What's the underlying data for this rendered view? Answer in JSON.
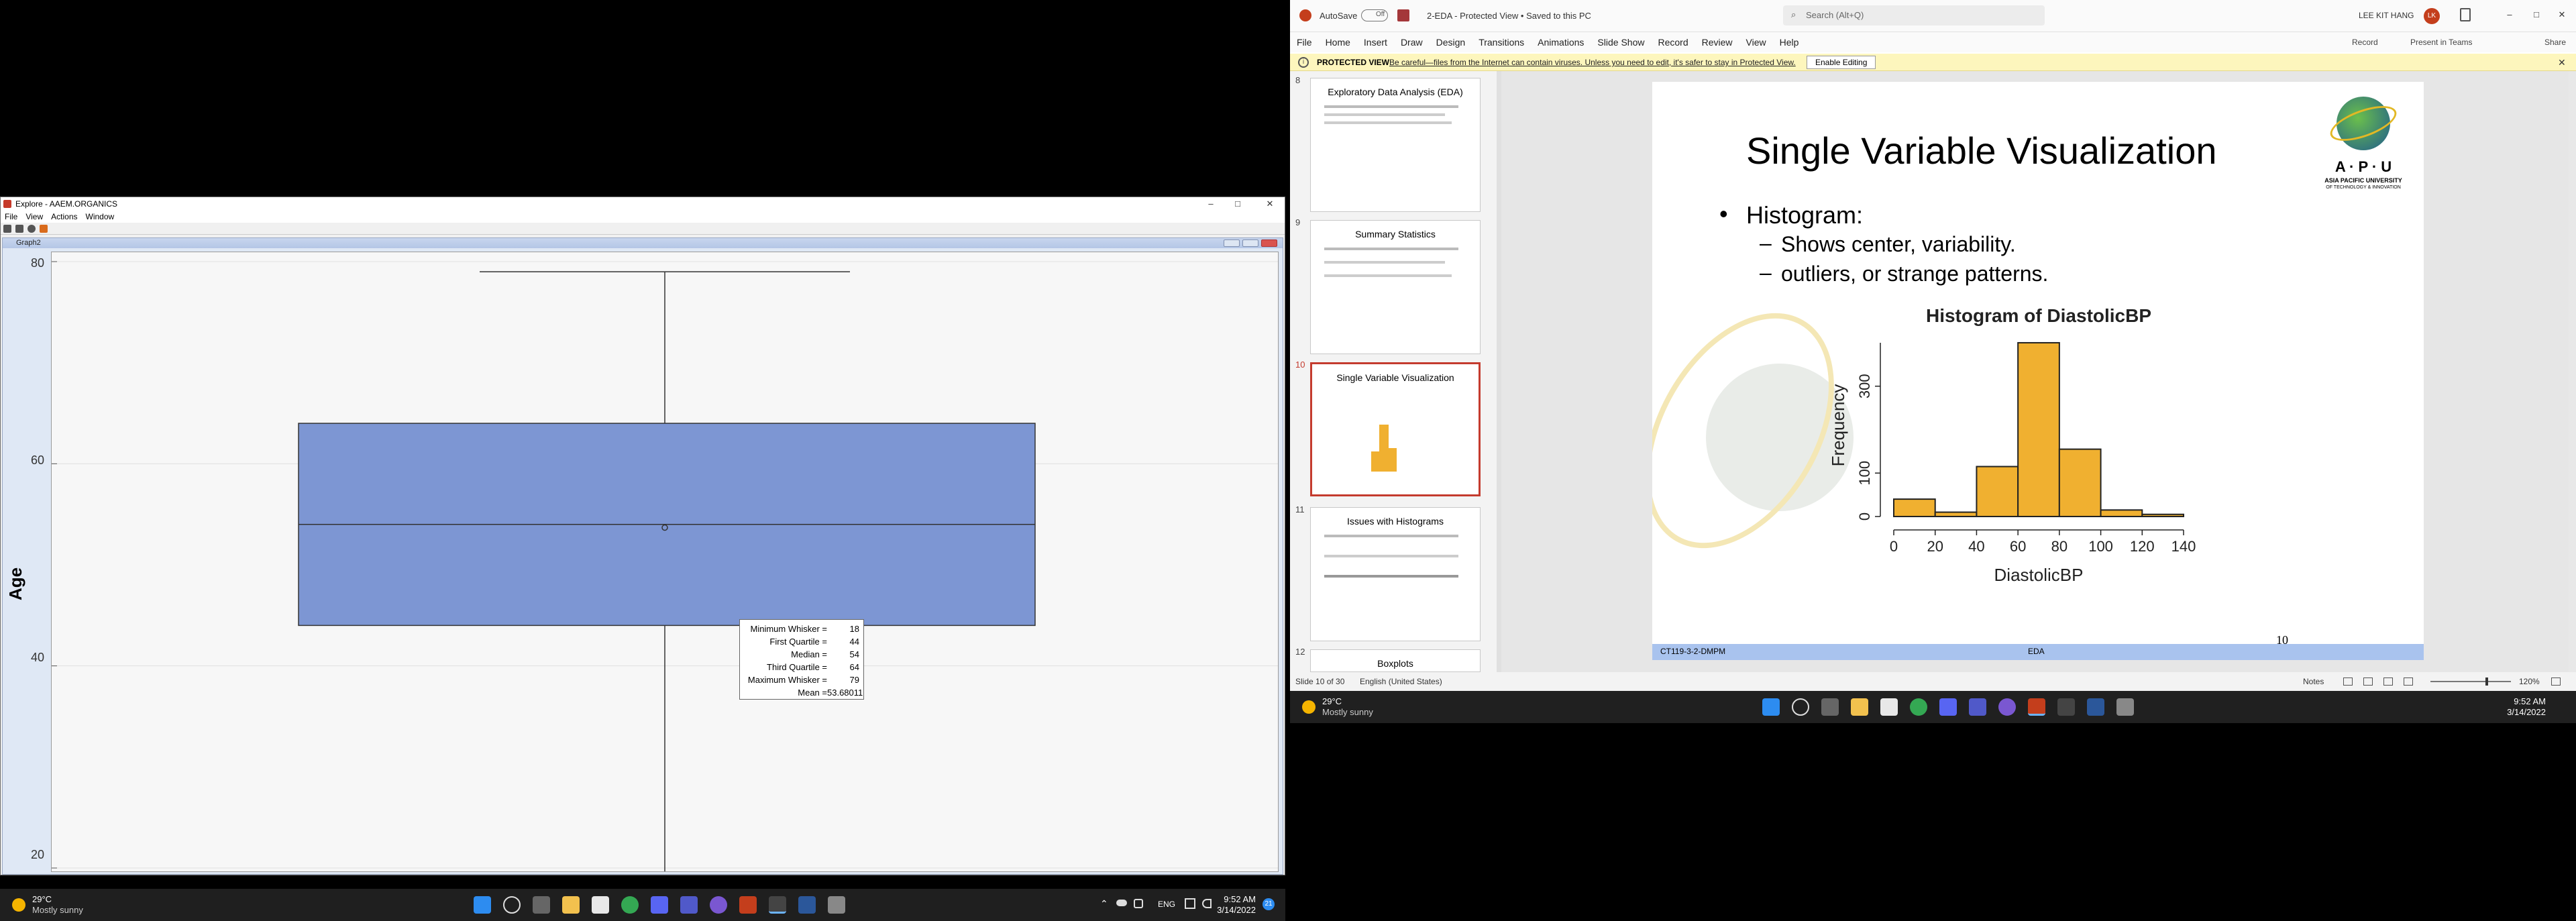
{
  "explore": {
    "title": "Explore - AAEM.ORGANICS",
    "menu": [
      "File",
      "View",
      "Actions",
      "Window"
    ],
    "graph_title": "Graph2",
    "y_axis_label": "Age",
    "y_ticks": [
      "80",
      "60",
      "40",
      "20"
    ],
    "tooltip": [
      {
        "label": "Minimum Whisker =",
        "value": "18"
      },
      {
        "label": "First Quartile =",
        "value": "44"
      },
      {
        "label": "Median =",
        "value": "54"
      },
      {
        "label": "Third Quartile =",
        "value": "64"
      },
      {
        "label": "Maximum Whisker =",
        "value": "79"
      },
      {
        "label": "Mean =",
        "value": "53.68011"
      }
    ]
  },
  "chart_data": [
    {
      "type": "boxplot",
      "ylabel": "Age",
      "ylim": [
        18,
        80
      ],
      "yticks": [
        20,
        40,
        60,
        80
      ],
      "min_whisker": 18,
      "q1": 44,
      "median": 54,
      "q3": 64,
      "max_whisker": 79,
      "mean": 53.68011,
      "box_color": "#7d96d3"
    },
    {
      "type": "bar",
      "title": "Histogram of DiastolicBP",
      "xlabel": "DiastolicBP",
      "ylabel": "Frequency",
      "categories": [
        "0-20",
        "20-40",
        "40-60",
        "60-80",
        "80-100",
        "100-120",
        "120-140"
      ],
      "values": [
        40,
        10,
        115,
        400,
        155,
        15,
        5
      ],
      "xticks": [
        0,
        20,
        40,
        60,
        80,
        100,
        120,
        140
      ],
      "yticks": [
        0,
        100,
        300
      ],
      "ylim": [
        0,
        420
      ],
      "bar_color": "#f0b030"
    }
  ],
  "taskbar_left": {
    "temp": "29°C",
    "condition": "Mostly sunny",
    "lang": "ENG",
    "time": "9:52 AM",
    "date": "3/14/2022",
    "notif": "21"
  },
  "ppt": {
    "autosave": "AutoSave",
    "autosave_state": "Off",
    "doc_title": "2-EDA  -  Protected View  •  Saved to this PC",
    "search_placeholder": "Search (Alt+Q)",
    "user_name": "LEE KIT HANG",
    "user_initials": "LK",
    "tabs": [
      "File",
      "Home",
      "Insert",
      "Draw",
      "Design",
      "Transitions",
      "Animations",
      "Slide Show",
      "Record",
      "Review",
      "View",
      "Help"
    ],
    "record_btn": "Record",
    "present_btn": "Present in Teams",
    "share_btn": "Share",
    "protected_label": "PROTECTED VIEW",
    "protected_msg": "Be careful—files from the Internet can contain viruses. Unless you need to edit, it's safer to stay in Protected View.",
    "enable_btn": "Enable Editing",
    "thumbnails": [
      {
        "num": "8",
        "title": "Exploratory Data Analysis (EDA)"
      },
      {
        "num": "9",
        "title": "Summary Statistics"
      },
      {
        "num": "10",
        "title": "Single Variable Visualization"
      },
      {
        "num": "11",
        "title": "Issues with Histograms"
      },
      {
        "num": "12",
        "title": "Boxplots"
      }
    ],
    "slide": {
      "title": "Single Variable Visualization",
      "bullet": "Histogram:",
      "sub1": "Shows center, variability.",
      "sub2": "outliers, or strange patterns.",
      "logo_text1": "A · P · U",
      "logo_text2": "ASIA PACIFIC UNIVERSITY",
      "logo_text3": "OF TECHNOLOGY & INNOVATION",
      "footer_left": "CT119-3-2-DMPM",
      "footer_mid": "EDA",
      "page_num": "10"
    },
    "status_slide": "Slide 10 of 30",
    "status_lang": "English (United States)",
    "notes": "Notes",
    "zoom": "120%"
  },
  "taskbar_right": {
    "temp": "29°C",
    "condition": "Mostly sunny",
    "time": "9:52 AM",
    "date": "3/14/2022"
  },
  "colors": {
    "box_fill": "#7d96d3",
    "hist_fill": "#f0b030",
    "slide_footer": "#a9c3ee",
    "protected_bar": "#fdf6bd",
    "selected_thumb": "#c43b2e"
  }
}
